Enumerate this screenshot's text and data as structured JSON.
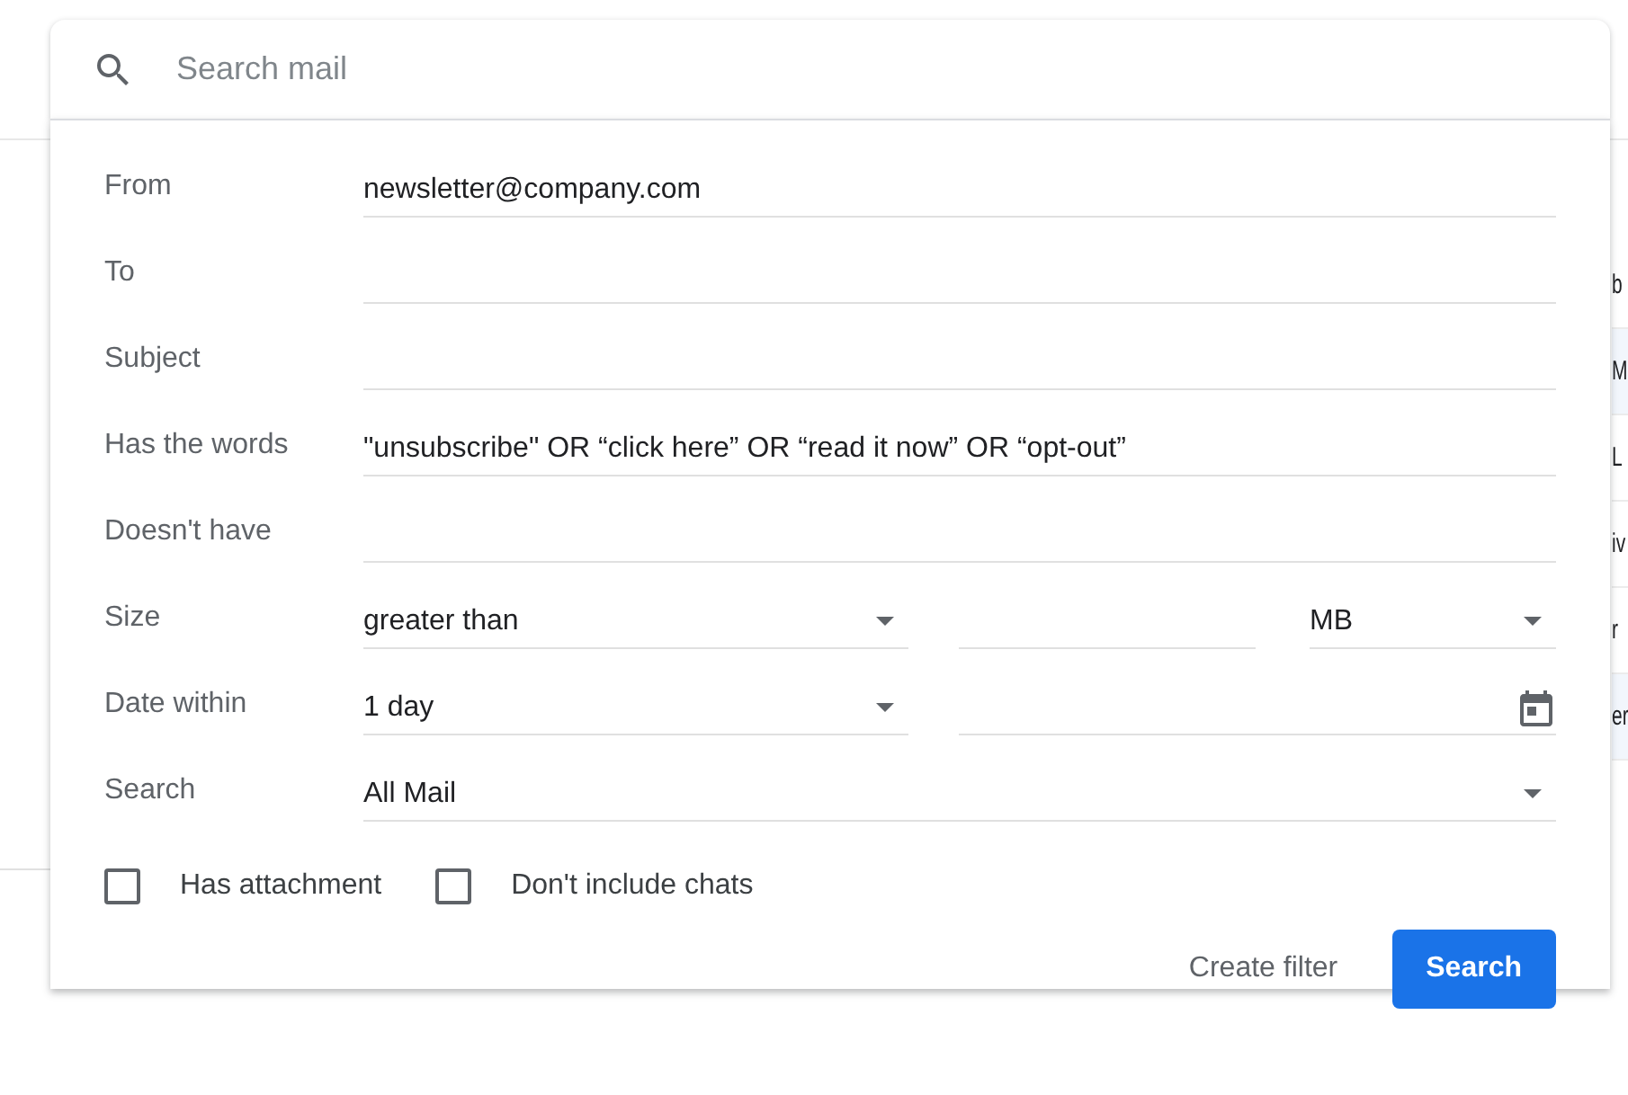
{
  "search_bar": {
    "placeholder": "Search mail"
  },
  "background_rows": [
    {
      "text": "b",
      "highlighted": false
    },
    {
      "text": "M",
      "highlighted": true
    },
    {
      "text": "L",
      "highlighted": false
    },
    {
      "text": "iv",
      "highlighted": false
    },
    {
      "text": "r",
      "highlighted": false
    },
    {
      "text": "er",
      "highlighted": true
    }
  ],
  "fields": [
    {
      "kind": "text",
      "label": "From",
      "value": "newsletter@company.com"
    },
    {
      "kind": "text",
      "label": "To"
    },
    {
      "kind": "text",
      "label": "Subject"
    },
    {
      "kind": "text",
      "label": "Has the words",
      "value": " \"unsubscribe\" OR “click here” OR “read it now” OR “opt-out”"
    },
    {
      "kind": "text",
      "label": "Doesn't have"
    },
    {
      "kind": "size",
      "label": "Size",
      "value": "greater than",
      "unit": "MB"
    },
    {
      "kind": "date",
      "label": "Date within",
      "value": "1 day"
    },
    {
      "kind": "select",
      "label": "Search",
      "value": "All Mail"
    }
  ],
  "checkboxes": [
    {
      "label": "Has attachment",
      "checked": false
    },
    {
      "label": "Don't include chats",
      "checked": false
    }
  ],
  "buttons": [
    {
      "kind": "text",
      "label": "Create filter"
    },
    {
      "kind": "primary",
      "label": "Search"
    }
  ]
}
